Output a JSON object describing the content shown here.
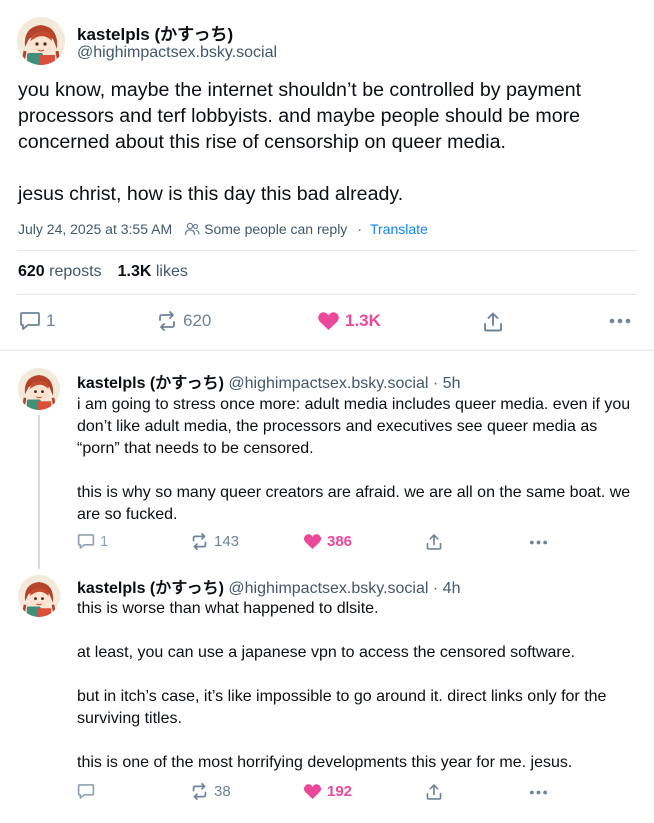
{
  "main_post": {
    "author_name": "kastelpls (かすっち)",
    "author_handle": "@highimpactsex.bsky.social",
    "text": "you know, maybe the internet shouldn’t be controlled by payment processors and terf lobbyists. and maybe people should be more concerned about this rise of censorship on queer media.\n\njesus christ, how is this day this bad already.",
    "timestamp": "July 24, 2025 at 3:55 AM",
    "reply_setting": "Some people can reply",
    "separator": "·",
    "translate_label": "Translate",
    "reposts_count": "620",
    "reposts_label": "reposts",
    "likes_count": "1.3K",
    "likes_label": "likes",
    "actions": {
      "reply_count": "1",
      "repost_count": "620",
      "like_count": "1.3K",
      "liked": true
    }
  },
  "replies": [
    {
      "author_name": "kastelpls (かすっち)",
      "author_handle": "@highimpactsex.bsky.social",
      "time": "· 5h",
      "text": "i am going to stress once more: adult media includes queer media. even if you don’t like adult media, the processors and executives see queer media as “porn” that needs to be censored.\n\nthis is why so many queer creators are afraid. we are all on the same boat. we are so fucked.",
      "reply_count": "1",
      "repost_count": "143",
      "like_count": "386",
      "liked": true
    },
    {
      "author_name": "kastelpls (かすっち)",
      "author_handle": "@highimpactsex.bsky.social",
      "time": "· 4h",
      "text": "this is worse than what happened to dlsite.\n\nat least, you can use a japanese vpn to access the censored software.\n\nbut in itch’s case, it’s like impossible to go around it. direct links only for the surviving titles.\n\nthis is one of the most horrifying developments this year for me. jesus.",
      "reply_count": "",
      "repost_count": "38",
      "like_count": "192",
      "liked": true
    }
  ],
  "colors": {
    "text": "#0b0f14",
    "muted": "#42576c",
    "icon": "#6f839a",
    "link": "#1083fe",
    "like": "#ec4899",
    "divider": "#e2e7ee"
  },
  "icons": [
    "avatar-illustration",
    "people-icon",
    "reply-icon",
    "repost-icon",
    "heart-icon",
    "share-icon",
    "more-icon"
  ]
}
